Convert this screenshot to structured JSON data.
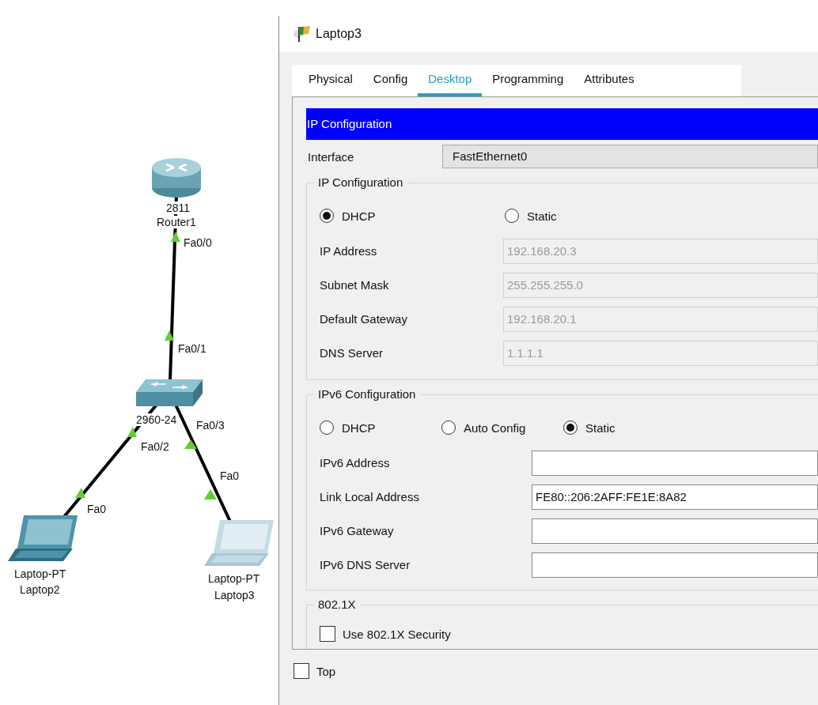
{
  "topology": {
    "devices": [
      {
        "kind": "router",
        "labels": [
          "2811",
          "Router1"
        ],
        "highlighted": false
      },
      {
        "kind": "switch",
        "labels": [
          "2960-24"
        ],
        "highlighted": false
      },
      {
        "kind": "laptop",
        "labels": [
          "Laptop-PT",
          "Laptop2"
        ],
        "highlighted": false
      },
      {
        "kind": "laptop",
        "labels": [
          "Laptop-PT",
          "Laptop3"
        ],
        "highlighted": true
      }
    ],
    "port_labels": [
      "Fa0/0",
      "Fa0/1",
      "Fa0/3",
      "Fa0/2",
      "Fa0",
      "Fa0"
    ]
  },
  "window": {
    "title": "Laptop3",
    "tabs": [
      {
        "label": "Physical",
        "selected": false
      },
      {
        "label": "Config",
        "selected": false
      },
      {
        "label": "Desktop",
        "selected": true
      },
      {
        "label": "Programming",
        "selected": false
      },
      {
        "label": "Attributes",
        "selected": false
      }
    ],
    "section_header": "IP Configuration",
    "interface": {
      "label": "Interface",
      "value": "FastEthernet0"
    },
    "groups": [
      {
        "kind": "ipv4",
        "title": "IP Configuration",
        "modes": [
          {
            "label": "DHCP",
            "selected": true
          },
          {
            "label": "Static",
            "selected": false
          }
        ],
        "fields": [
          {
            "label": "IP Address",
            "value": "192.168.20.3",
            "disabled": true
          },
          {
            "label": "Subnet Mask",
            "value": "255.255.255.0",
            "disabled": true
          },
          {
            "label": "Default Gateway",
            "value": "192.168.20.1",
            "disabled": true
          },
          {
            "label": "DNS Server",
            "value": "1.1.1.1",
            "disabled": true
          }
        ]
      },
      {
        "kind": "ipv6",
        "title": "IPv6 Configuration",
        "modes": [
          {
            "label": "DHCP",
            "selected": false
          },
          {
            "label": "Auto Config",
            "selected": false
          },
          {
            "label": "Static",
            "selected": true
          }
        ],
        "fields": [
          {
            "label": "IPv6 Address",
            "disabled": false
          },
          {
            "label": "Link Local Address",
            "value": "FE80::206:2AFF:FE1E:8A82",
            "disabled": false
          },
          {
            "label": "IPv6 Gateway",
            "disabled": false
          },
          {
            "label": "IPv6 DNS Server",
            "disabled": false
          }
        ]
      },
      {
        "kind": "dot1x",
        "title": "802.1X",
        "checkbox": {
          "label": "Use 802.1X Security",
          "checked": false
        }
      }
    ],
    "top_checkbox": {
      "label": "Top",
      "checked": false
    }
  }
}
